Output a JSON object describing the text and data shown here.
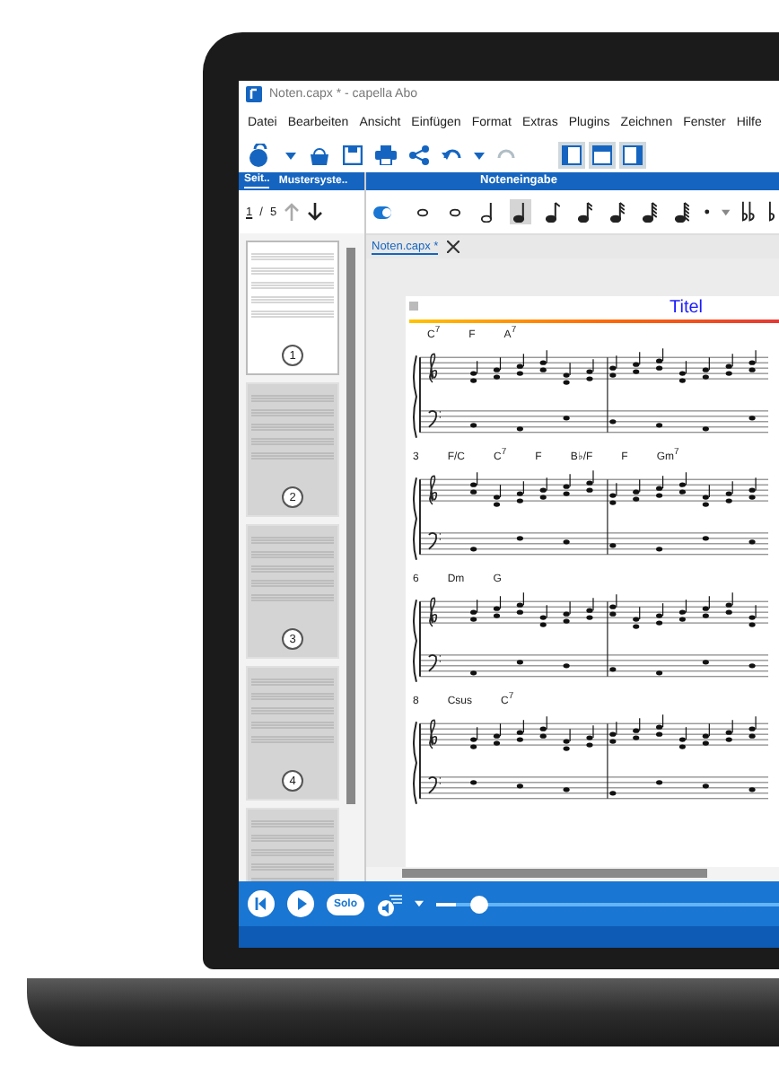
{
  "window": {
    "title": "Noten.capx * - capella Abo"
  },
  "menu": [
    "Datei",
    "Bearbeiten",
    "Ansicht",
    "Einfügen",
    "Format",
    "Extras",
    "Plugins",
    "Zeichnen",
    "Fenster",
    "Hilfe"
  ],
  "side_panel": {
    "tabs": [
      {
        "label": "Seit..",
        "selected": true
      },
      {
        "label": "Mustersyste..",
        "selected": false
      }
    ],
    "page_current": "1",
    "page_separator": "/",
    "page_total": "5",
    "thumbnails": [
      {
        "number": "1",
        "selected": true
      },
      {
        "number": "2",
        "selected": false
      },
      {
        "number": "3",
        "selected": false
      },
      {
        "number": "4",
        "selected": false
      },
      {
        "selected": false
      }
    ]
  },
  "note_input": {
    "title": "Noteneingabe",
    "toggle_on": true,
    "durations": [
      {
        "selected": false
      },
      {
        "selected": false
      },
      {
        "selected": false
      },
      {
        "selected": true
      },
      {
        "selected": false
      },
      {
        "selected": false
      },
      {
        "selected": false
      },
      {
        "selected": false
      },
      {
        "selected": false
      }
    ]
  },
  "document": {
    "tab": "Noten.capx *",
    "title": "Titel",
    "systems": [
      {
        "chords": [
          "C$^{7}$",
          "F",
          "A$^{7}$"
        ]
      },
      {
        "measure": "3",
        "chords": [
          "F/C",
          "C$^{7}$",
          "F",
          "B♭/F",
          "F",
          "Gm$^{7}$"
        ]
      },
      {
        "measure": "6",
        "chords": [
          "Dm",
          "G"
        ]
      },
      {
        "measure": "8",
        "chords": [
          "Csus",
          "C$^{7}$"
        ]
      }
    ]
  },
  "player": {
    "solo": "Solo",
    "level": 0.06
  }
}
